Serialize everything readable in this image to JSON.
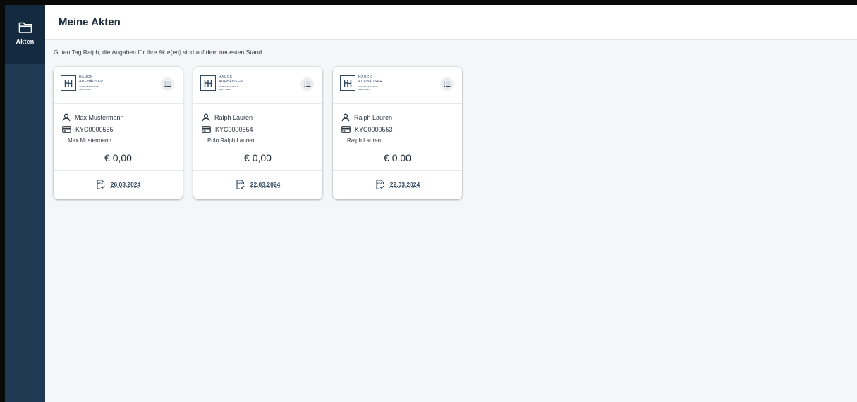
{
  "sidebar": {
    "items": [
      {
        "label": "Akten",
        "icon": "folder-icon",
        "active": true
      }
    ]
  },
  "header": {
    "title": "Meine Akten"
  },
  "greeting": "Guten Tag Ralph, die Angaben für Ihre Akte(en) sind auf dem neuesten Stand.",
  "brand": {
    "line1": "HAUCK",
    "line2": "AUFHÄUSER",
    "line3": "ADMINISTRATION",
    "line4": "SERVICES",
    "color": "#304a64"
  },
  "cards": [
    {
      "owner": "Max Mustermann",
      "kyc": "KYC0000555",
      "account_name": "Max Mustermann",
      "amount": "€ 0,00",
      "date": "26.03.2024"
    },
    {
      "owner": "Ralph Lauren",
      "kyc": "KYC0000554",
      "account_name": "Polo Ralph Lauren",
      "amount": "€ 0,00",
      "date": "22.03.2024"
    },
    {
      "owner": "Ralph Lauren",
      "kyc": "KYC0000553",
      "account_name": "Ralph Lauren",
      "amount": "€ 0,00",
      "date": "22.03.2024"
    }
  ],
  "icons": {
    "nav": "folder-icon",
    "menu": "list-icon",
    "owner": "person-icon",
    "kyc": "credit-card-icon",
    "document": "pdf-icon"
  },
  "colors": {
    "sidebar": "#1f3a52",
    "sidebar_active": "#142a3e",
    "page_bg": "#f4f6f8",
    "card_bg": "#ffffff"
  }
}
